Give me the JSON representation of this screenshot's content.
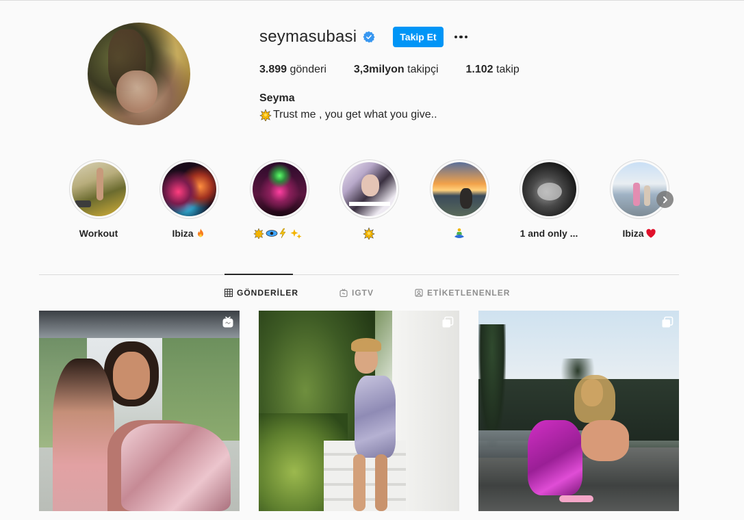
{
  "profile": {
    "username": "seymasubasi",
    "verified": true,
    "follow_label": "Takip Et",
    "posts_count": "3.899",
    "posts_label": "gönderi",
    "followers_count": "3,3milyon",
    "followers_label": "takipçi",
    "following_count": "1.102",
    "following_label": "takip",
    "full_name": "Seyma",
    "bio": "Trust me , you get what you give.."
  },
  "highlights": [
    {
      "label": "Workout",
      "icon": "none"
    },
    {
      "label": "Ibiza",
      "icon": "fire-emoji"
    },
    {
      "label": "",
      "icon": "sparkle-eye-lightning-sparkles-emoji"
    },
    {
      "label": "",
      "icon": "sparkle-emoji"
    },
    {
      "label": "",
      "icon": "meditation-emoji"
    },
    {
      "label": "1 and only ...",
      "icon": "none"
    },
    {
      "label": "Ibiza",
      "icon": "heart-emoji"
    }
  ],
  "tabs": [
    {
      "label": "GÖNDERİLER",
      "icon": "grid-icon",
      "active": true
    },
    {
      "label": "IGTV",
      "icon": "igtv-icon",
      "active": false
    },
    {
      "label": "ETİKETLENENLER",
      "icon": "tagged-icon",
      "active": false
    }
  ],
  "posts": [
    {
      "badge": "igtv-icon"
    },
    {
      "badge": "carousel-icon"
    },
    {
      "badge": "carousel-icon"
    }
  ],
  "colors": {
    "accent": "#0095f6",
    "text": "#262626",
    "muted": "#8e8e8e",
    "background": "#fafafa",
    "border": "#dbdbdb"
  }
}
